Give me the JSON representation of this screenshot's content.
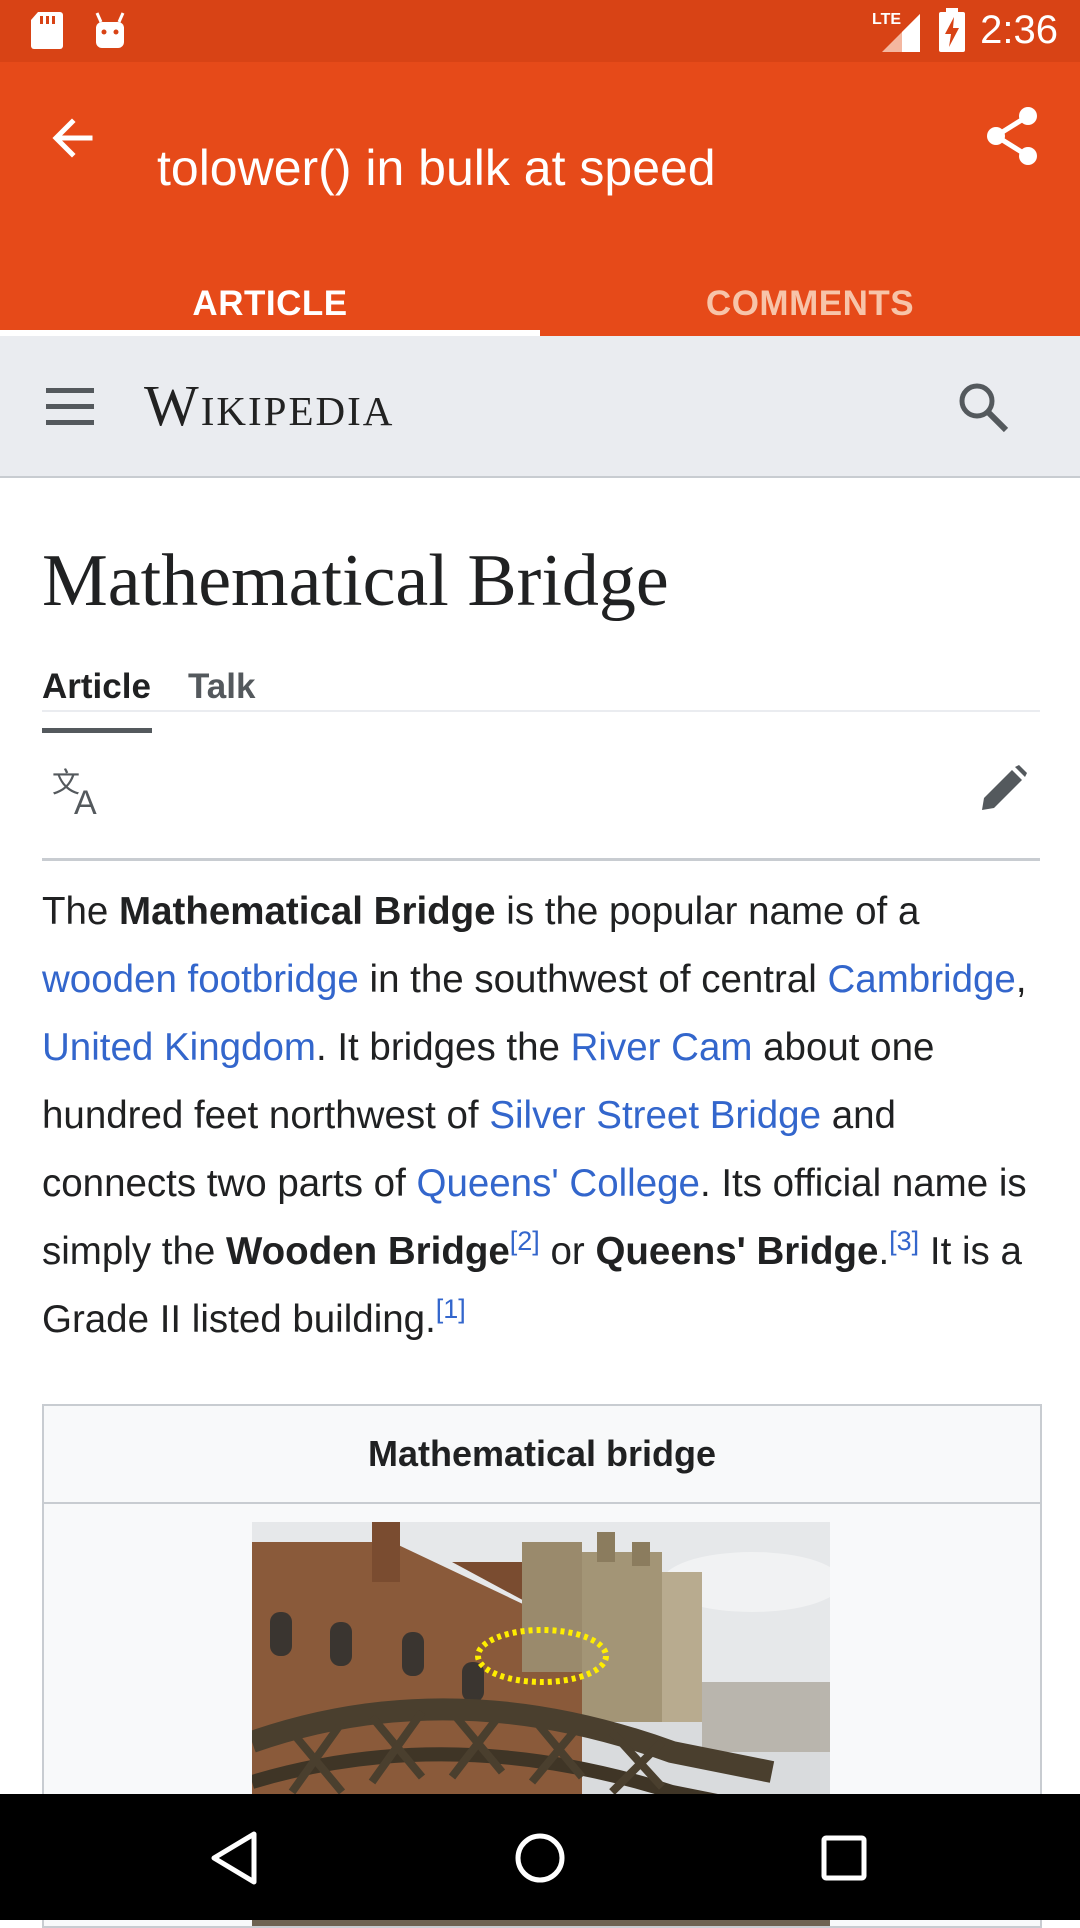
{
  "status_bar": {
    "network": "LTE",
    "time": "2:36"
  },
  "app_bar": {
    "title": "tolower() in bulk at speed"
  },
  "app_tabs": [
    {
      "label": "ARTICLE",
      "active": true
    },
    {
      "label": "COMMENTS",
      "active": false
    }
  ],
  "wiki_header": {
    "logo": "Wikipedia"
  },
  "article": {
    "title": "Mathematical Bridge",
    "tabs": [
      "Article",
      "Talk"
    ],
    "paragraph": {
      "t1": "The ",
      "b1": "Mathematical Bridge",
      "t2": " is the popular name of a ",
      "l1": "wooden footbridge",
      "t3": " in the southwest of central ",
      "l2": "Cambridge",
      "t4": ", ",
      "l3": "United Kingdom",
      "t5": ". It bridges the ",
      "l4": "River Cam",
      "t6": " about one hundred feet northwest of ",
      "l5": "Silver Street Bridge",
      "t7": " and connects two parts of ",
      "l6": "Queens' College",
      "t8": ". Its official name is simply the ",
      "b2": "Wooden Bridge",
      "s1": "[2]",
      "t9": " or ",
      "b3": "Queens' Bridge",
      "t10": ".",
      "s2": "[3]",
      "t11": " It is a Grade II listed building.",
      "s3": "[1]"
    },
    "infobox": {
      "title": "Mathematical bridge"
    }
  },
  "colors": {
    "status_bar": "#d84315",
    "app_bar": "#e64a19",
    "link": "#3366cc",
    "wiki_header_bg": "#eaecf0"
  },
  "icons": {
    "back": "arrow-left-icon",
    "share": "share-icon",
    "menu": "hamburger-menu-icon",
    "search": "search-icon",
    "language": "translate-icon",
    "edit": "pencil-icon"
  }
}
